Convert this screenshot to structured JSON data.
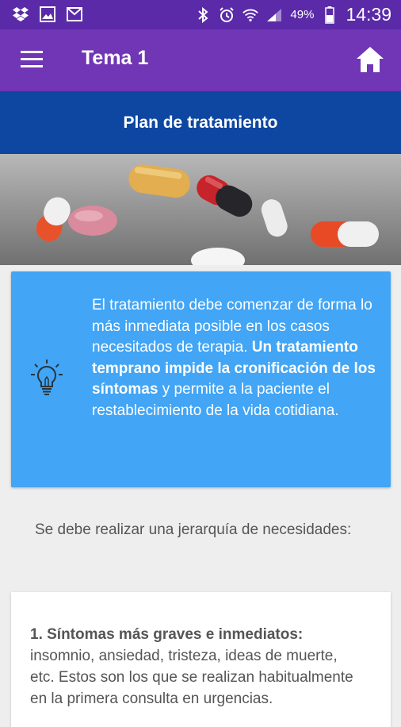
{
  "status_bar": {
    "battery_percent": "49%",
    "time": "14:39",
    "left_icons": [
      "dropbox-icon",
      "image-icon",
      "gmail-icon"
    ],
    "right_icons": [
      "bluetooth-icon",
      "alarm-icon",
      "wifi-icon",
      "signal-icon",
      "battery-icon"
    ]
  },
  "app_bar": {
    "title": "Tema 1",
    "menu_icon": "hamburger-menu-icon",
    "home_icon": "home-icon"
  },
  "section": {
    "title": "Plan de tratamiento"
  },
  "hero_image": {
    "subject": "pills"
  },
  "info_card": {
    "icon": "lightbulb-icon",
    "text_part1": "El tratamiento debe comenzar de forma lo más inmediata posible en los casos necesitados de terapia.",
    "text_bold": "Un tratamiento temprano impide la cronificación de los síntomas",
    "text_part2": "y permite a la paciente el restablecimiento de la vida cotidiana."
  },
  "paragraph": {
    "text": "Se debe realizar una jerarquía de necesidades:"
  },
  "card2": {
    "heading": "1. Síntomas más graves e inmediatos:",
    "text": "insomnio, ansiedad, tristeza, ideas de muerte, etc. Estos son los que se realizan habitualmente en la primera consulta en urgencias."
  },
  "colors": {
    "status_bar": "#5a2aa8",
    "app_bar": "#7036b5",
    "section_bar": "#0d47a1",
    "info_card": "#42a5f5",
    "background": "#eeeeee"
  }
}
